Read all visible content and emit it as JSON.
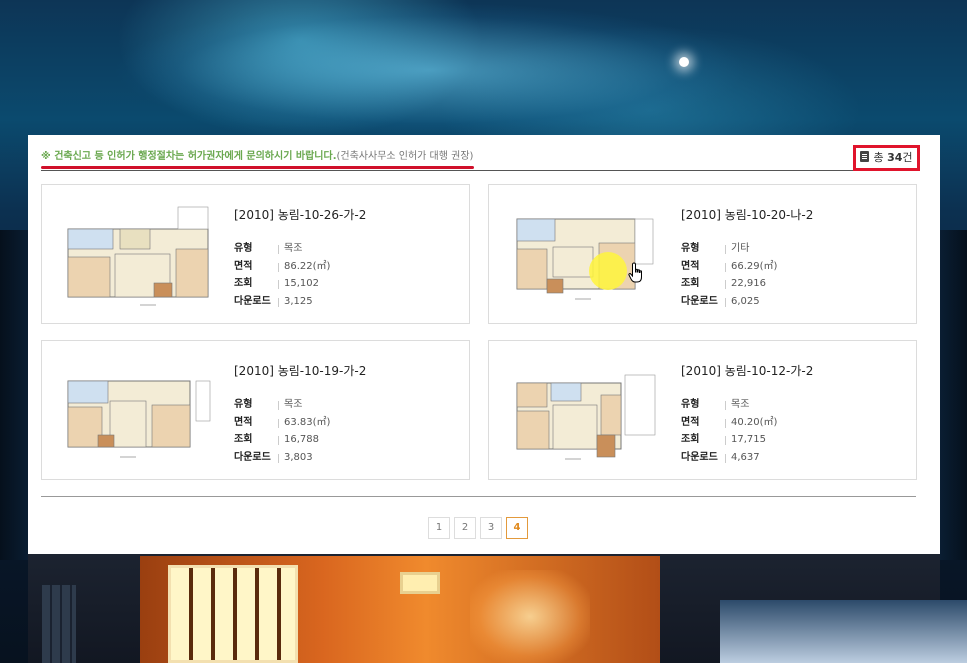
{
  "notice": {
    "main": "※ 건축신고 등 인허가 행정절차는 허가권자에게 문의하시기 바랍니다.",
    "sub": "(건축사사무소 인허가 대행 권장)"
  },
  "total": {
    "prefix": "총",
    "count": "34",
    "suffix": "건"
  },
  "labels": {
    "type": "유형",
    "area": "면적",
    "views": "조회",
    "downloads": "다운로드"
  },
  "listings": [
    {
      "title": "[2010] 농림-10-26-가-2",
      "type": "목조",
      "area": "86.22(㎡)",
      "views": "15,102",
      "downloads": "3,125"
    },
    {
      "title": "[2010] 농림-10-20-나-2",
      "type": "기타",
      "area": "66.29(㎡)",
      "views": "22,916",
      "downloads": "6,025"
    },
    {
      "title": "[2010] 농림-10-19-가-2",
      "type": "목조",
      "area": "63.83(㎡)",
      "views": "16,788",
      "downloads": "3,803"
    },
    {
      "title": "[2010] 농림-10-12-가-2",
      "type": "목조",
      "area": "40.20(㎡)",
      "views": "17,715",
      "downloads": "4,637"
    }
  ],
  "pagination": {
    "pages": [
      "1",
      "2",
      "3",
      "4"
    ],
    "current": "4"
  },
  "colors": {
    "notice_text": "#6aa84f",
    "highlight_red": "#e0142c",
    "active_page": "#e08a1e"
  }
}
